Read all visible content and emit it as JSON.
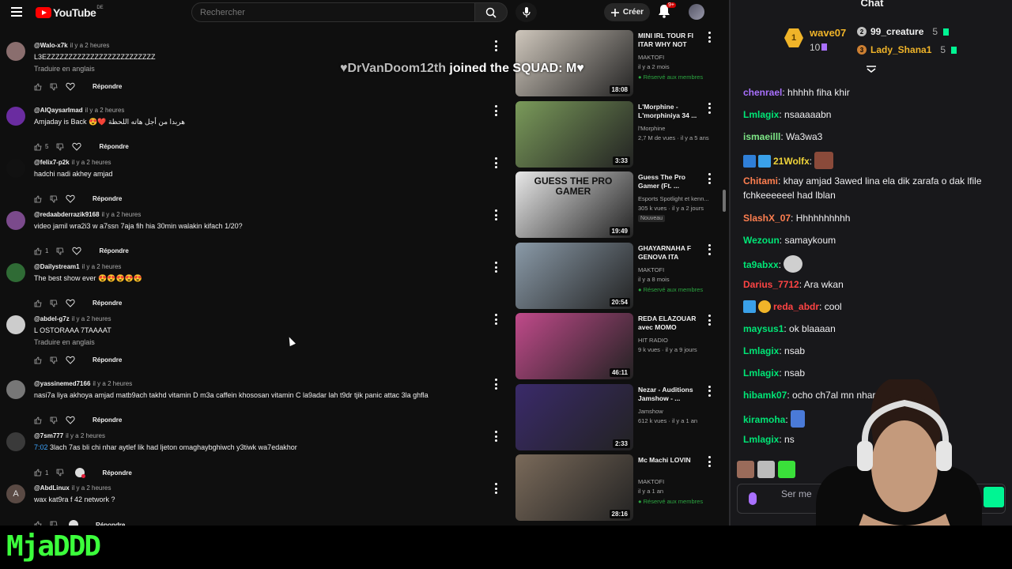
{
  "youtube": {
    "logo_text": "YouTube",
    "country_code": "DE",
    "search_placeholder": "Rechercher",
    "create_label": "Créer",
    "notif_count": "9+"
  },
  "overlay": {
    "join_name": "♥DrVanDoom12th",
    "join_text": " joined the SQUAD: M♥"
  },
  "comments": [
    {
      "author": "@Walo-x7k",
      "time": "il y a 2 heures",
      "text": "L3EZZZZZZZZZZZZZZZZZZZZZZZZZ",
      "translate": "Traduire en anglais",
      "likes": "",
      "reply": "Répondre",
      "avatar_color": "#8a6e6e"
    },
    {
      "author": "@AlQaysarImad",
      "time": "il y a 2 heures",
      "text": "Amjaday is Back 😍❤️ هربدا من أجل هاته اللحظة",
      "translate": "",
      "likes": "5",
      "reply": "Répondre",
      "avatar_color": "#6a2ca0"
    },
    {
      "author": "@felix7-p2k",
      "time": "il y a 2 heures",
      "text": "hadchi nadi akhey amjad",
      "translate": "",
      "likes": "",
      "reply": "Répondre",
      "avatar_color": "#111111"
    },
    {
      "author": "@redaabderrazik9168",
      "time": "il y a 2 heures",
      "text": "video jamil wra2i3 w a7ssn 7aja fih hia 30min walakin kifach 1/20?",
      "translate": "",
      "likes": "1",
      "reply": "Répondre",
      "avatar_color": "#7b4a8c"
    },
    {
      "author": "@Dailystream1",
      "time": "il y a 2 heures",
      "text": "The best show ever 😍😍😍😍😍",
      "translate": "",
      "likes": "",
      "reply": "Répondre",
      "avatar_color": "#2f6b35"
    },
    {
      "author": "@abdel-g7z",
      "time": "il y a 2 heures",
      "text": "L OSTORAAA 7TAAAAT",
      "translate": "Traduire en anglais",
      "likes": "",
      "reply": "Répondre",
      "avatar_color": "#cccccc"
    },
    {
      "author": "@yassinemed7166",
      "time": "il y a 2 heures",
      "text": "nasi7a liya akhoya amjad matb9ach takhd vitamin D m3a caffein  khososan vitamin C la9adar lah t9dr tjik panic attac 3la ghfla",
      "translate": "",
      "likes": "",
      "reply": "Répondre",
      "avatar_color": "#777777"
    },
    {
      "author": "@7sm777",
      "time": "il y a 2 heures",
      "timestamp": "7:02",
      "text": " 3lach 7as bli chi nhar aytlef lik had ljeton omaghaybghiwch y3tiwk wa7edakhor",
      "translate": "",
      "likes": "1",
      "reply": "Répondre",
      "avatar_color": "#3a3a3a"
    },
    {
      "author": "@AbdLinux",
      "time": "il y a 2 heures",
      "text": "wax kat9ra f 42 network ?",
      "translate": "",
      "likes": "",
      "reply": "Répondre",
      "avatar_color": "#5a4a44",
      "avatar_letter": "A"
    }
  ],
  "related": [
    {
      "title": "MINI IRL TOUR FI ITAR WHY NOT",
      "channel": "MAKTOFI",
      "meta": "il y a 2 mois",
      "badge": "Réservé aux membres",
      "duration": "18:08",
      "thumb": "#cfc7bc",
      "new": ""
    },
    {
      "title": "L'Morphine - L'morphiniya 34 ...",
      "channel": "l'Morphine",
      "meta": "2,7 M de vues · il y a 5 ans",
      "badge": "",
      "duration": "3:33",
      "thumb": "#7a9a5a",
      "new": ""
    },
    {
      "title": "Guess The Pro Gamer (Ft. ...",
      "channel": "Esports Spotlight et kenn...",
      "meta": "305 k vues · il y a 2 jours",
      "badge": "",
      "duration": "19:49",
      "thumb": "#e8e8e8",
      "new": "Nouveau",
      "thumb_text": "GUESS THE PRO GAMER"
    },
    {
      "title": "GHAYARNAHA F GENOVA ITA",
      "channel": "MAKTOFI",
      "meta": "il y a 8 mois",
      "badge": "Réservé aux membres",
      "duration": "20:54",
      "thumb": "#8a9aa8",
      "new": ""
    },
    {
      "title": "REDA ELAZOUAR avec MOMO",
      "channel": "HIT RADIO",
      "meta": "9 k vues · il y a 9 jours",
      "badge": "",
      "duration": "46:11",
      "thumb": "#c04a8a",
      "new": ""
    },
    {
      "title": "Nezar - Auditions Jamshow - ...",
      "channel": "Jamshow",
      "meta": "612 k vues · il y a 1 an",
      "badge": "",
      "duration": "2:33",
      "thumb": "#3a2a6a",
      "new": ""
    },
    {
      "title": "Mc Machi LOVIN",
      "channel": "MAKTOFI",
      "meta": "il y a 1 an",
      "badge": "Réservé aux membres",
      "duration": "28:16",
      "thumb": "#7a6a5a",
      "new": ""
    }
  ],
  "chat": {
    "title": "Chat",
    "leaderboard": {
      "first": {
        "rank": "1",
        "name": "wave07",
        "points": "10"
      },
      "second": {
        "rank": "2",
        "name": "99_creature",
        "points": "5"
      },
      "third": {
        "rank": "3",
        "name": "Lady_Shana1",
        "points": "5"
      }
    },
    "messages": [
      {
        "user": "chenrael",
        "color": "#a970ff",
        "text": "hhhhh fiha khir"
      },
      {
        "user": "Lmlagix",
        "color": "#00e676",
        "text": "nsaaaaabn"
      },
      {
        "user": "ismaeilll",
        "color": "#7ee787",
        "text": "Wa3wa3"
      },
      {
        "user": "21Wolfx",
        "color": "#f0d43a",
        "text": ""
      },
      {
        "user": "Chitami",
        "color": "#ff7f50",
        "text": "khay amjad 3awed lina ela dik zarafa o dak lfile fchkeeeeeel had lblan"
      },
      {
        "user": "SlashX_07",
        "color": "#ff7f50",
        "text": "Hhhhhhhhhh"
      },
      {
        "user": "Wezoun",
        "color": "#00e676",
        "text": "samaykoum"
      },
      {
        "user": "ta9abxx",
        "color": "#00e676",
        "text": ""
      },
      {
        "user": "Darius_7712",
        "color": "#ff4444",
        "text": "Ara wkan"
      },
      {
        "user": "reda_abdr",
        "color": "#ff4444",
        "text": "cool"
      },
      {
        "user": "maysus1",
        "color": "#00e676",
        "text": "ok blaaaan"
      },
      {
        "user": "Lmlagix",
        "color": "#00e676",
        "text": "nsab"
      },
      {
        "user": "Lmlagix",
        "color": "#00e676",
        "text": "nsab"
      },
      {
        "user": "hibamk07",
        "color": "#00e676",
        "text": "ocho ch7al mn nhar bl"
      },
      {
        "user": "kiramoha",
        "color": "#00e676",
        "text": ""
      },
      {
        "user": "Lmlagix",
        "color": "#00e676",
        "text": "ns"
      }
    ],
    "input_placeholder": "Ser me"
  },
  "brand": "MjaDDD"
}
